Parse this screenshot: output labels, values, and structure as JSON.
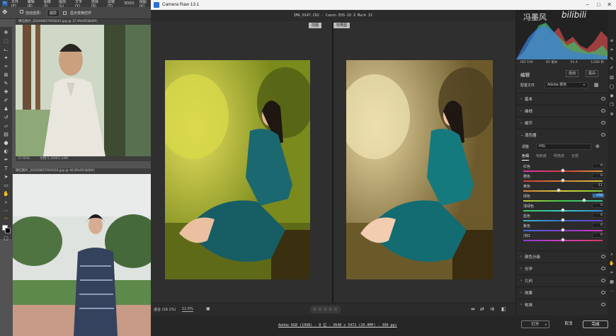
{
  "photoshop": {
    "menu": [
      "文件(F)",
      "编辑(E)",
      "图像(I)",
      "图层(L)",
      "文字(Y)",
      "选择(S)",
      "滤镜(T)",
      "3D(D)",
      "视图(V)"
    ],
    "options": {
      "auto_select": "自动选择：",
      "layer": "图层",
      "show_transform": "显示变换控件"
    },
    "doc1": {
      "tab": "微信图片_20200607092643.jpg @ 37.9%(RGB/8#)",
      "zoom": "37.95%",
      "doc_size": "文档:5.34M/5.34M"
    },
    "doc2": {
      "tab": "微信图片_20200607092626.jpg @ 40.8%(RGB/8#)"
    }
  },
  "camera_raw": {
    "title": "Camera Raw 13.1",
    "file_info": "IMG_0147.CR2 - Canon EOS-1D X Mark II",
    "view_before": "前图",
    "view_after": "效果图",
    "bottom": {
      "fit": "适合 (16.1%)",
      "zoom": "12.5%",
      "rating_stars": "☆ ☆ ☆ ☆ ☆"
    },
    "status_link": "Adobe RGB (1998) - 8 位 - 3648 x 5472 (20.0MP) - 300 ppi",
    "buttons": {
      "open": "打开",
      "cancel": "取消",
      "done": "完成"
    },
    "camera_info": [
      "ISO 100",
      "85 毫米",
      "f/1.4",
      "1/160 秒"
    ],
    "watermark": "冯墨风",
    "bilibili": "bilibili",
    "panel": {
      "edit_title": "编辑",
      "auto": "自动",
      "bw": "黑白",
      "profile_label": "配置文件",
      "profile_value": "Adobe 颜色",
      "sections_top": [
        "基本",
        "曲线",
        "细节"
      ],
      "mixer": {
        "title": "混色器",
        "adjust_label": "调整",
        "adjust_value": "HSL",
        "tabs": [
          "色相",
          "饱和度",
          "明亮度",
          "全部"
        ],
        "sliders": [
          {
            "label": "红色",
            "value": "0",
            "pos": 0.5
          },
          {
            "label": "橙色",
            "value": "0",
            "pos": 0.5
          },
          {
            "label": "黄色",
            "value": "-11",
            "pos": 0.45
          },
          {
            "label": "绿色",
            "value": "+54",
            "pos": 0.77
          },
          {
            "label": "浅绿色",
            "value": "0",
            "pos": 0.5
          },
          {
            "label": "蓝色",
            "value": "0",
            "pos": 0.5
          },
          {
            "label": "紫色",
            "value": "0",
            "pos": 0.5
          },
          {
            "label": "洋红",
            "value": "0",
            "pos": 0.5
          }
        ]
      },
      "sections_bottom": [
        "颜色分级",
        "光学",
        "几何",
        "效果",
        "校准"
      ]
    },
    "colors": {
      "accent_green_value": "#2a6fb5"
    }
  }
}
